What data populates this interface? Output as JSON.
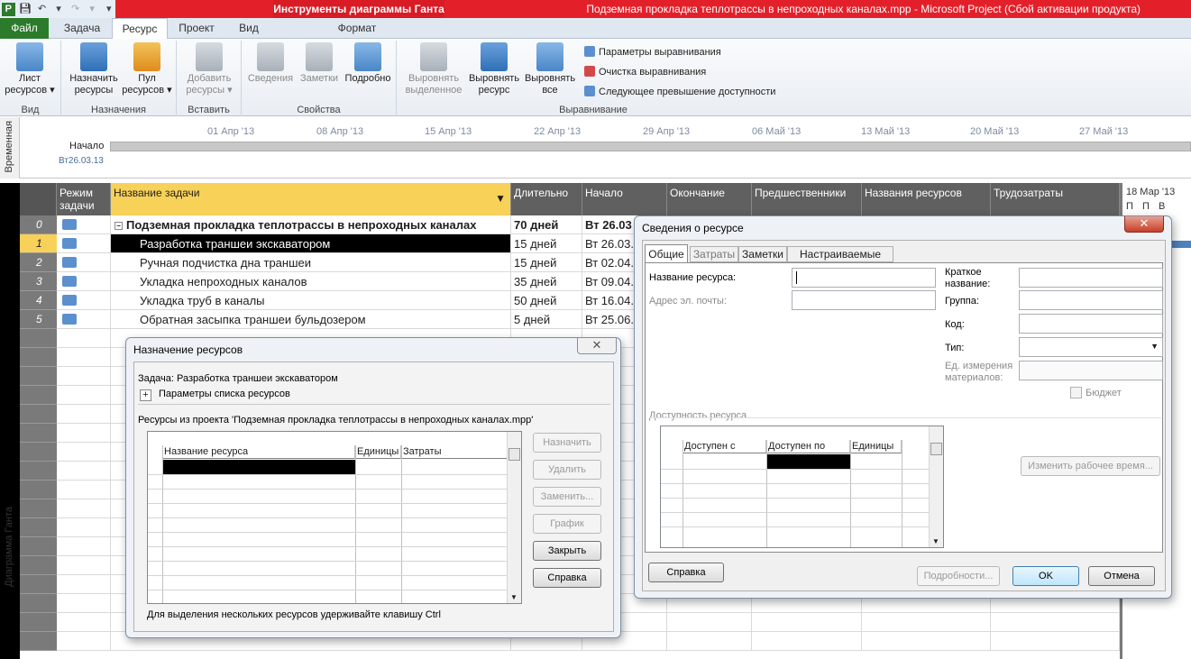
{
  "colors": {
    "titlebar": "#e3202a",
    "file_tab": "#2b7b2b",
    "selected": "#f7d158"
  },
  "titlebar": {
    "contextual_group": "Инструменты диаграммы Ганта",
    "window_title": "Подземная прокладка теплотрассы в непроходных каналах.mpp  -  Microsoft Project (Сбой активации продукта)"
  },
  "tabs": {
    "file": "Файл",
    "task": "Задача",
    "resource": "Ресурс",
    "project": "Проект",
    "view": "Вид",
    "format": "Формат"
  },
  "ribbon": {
    "view_group": "Вид",
    "resource_sheet": "Лист ресурсов",
    "assign_group": "Назначения",
    "assign_resources": "Назначить ресурсы",
    "resource_pool": "Пул ресурсов",
    "insert_group": "Вставить",
    "add_resources": "Добавить ресурсы",
    "props_group": "Свойства",
    "info": "Сведения",
    "notes": "Заметки",
    "details": "Подробно",
    "level_group": "Выравнивание",
    "level_selection": "Выровнять выделенное",
    "level_resource": "Выровнять ресурс",
    "level_all": "Выровнять все",
    "leveling_options": "Параметры выравнивания",
    "clear_leveling": "Очистка выравнивания",
    "next_overallocation": "Следующее превышение доступности"
  },
  "timeline": {
    "side_label": "Временная",
    "start_label": "Начало",
    "start_date": "Вт26.03.13",
    "dates": [
      "01 Апр '13",
      "08 Апр '13",
      "15 Апр '13",
      "22 Апр '13",
      "29 Апр '13",
      "06 Май '13",
      "13 Май '13",
      "20 Май '13",
      "27 Май '13"
    ]
  },
  "gantt": {
    "side_label": "Диаграмма Ганта",
    "headers": {
      "mode": "Режим задачи",
      "name": "Название задачи",
      "duration": "Длительно",
      "start": "Начало",
      "finish": "Окончание",
      "pred": "Предшественники",
      "resources": "Названия ресурсов",
      "work": "Трудозатраты"
    },
    "chart_header": "18 Мар '13",
    "chart_days": [
      "П",
      "П",
      "В"
    ],
    "rows": [
      {
        "id": "0",
        "name": "Подземная прокладка теплотрассы в непроходных каналах",
        "duration": "70 дней",
        "start": "Вт 26.03"
      },
      {
        "id": "1",
        "name": "Разработка траншеи экскаватором",
        "duration": "15 дней",
        "start": "Вт 26.03."
      },
      {
        "id": "2",
        "name": "Ручная подчистка дна траншеи",
        "duration": "15 дней",
        "start": "Вт 02.04."
      },
      {
        "id": "3",
        "name": "Укладка непроходных каналов",
        "duration": "35 дней",
        "start": "Вт 09.04."
      },
      {
        "id": "4",
        "name": "Укладка труб в каналы",
        "duration": "50 дней",
        "start": "Вт 16.04."
      },
      {
        "id": "5",
        "name": "Обратная засыпка траншеи бульдозером",
        "duration": "5 дней",
        "start": "Вт 25.06."
      }
    ]
  },
  "assign_dialog": {
    "title": "Назначение ресурсов",
    "task_line": "Задача: Разработка траншеи экскаватором",
    "list_options": "Параметры списка ресурсов",
    "resources_from": "Ресурсы из проекта 'Подземная прокладка теплотрассы в непроходных каналах.mpp'",
    "col_name": "Название ресурса",
    "col_units": "Единицы",
    "col_cost": "Затраты",
    "btn_assign": "Назначить",
    "btn_remove": "Удалить",
    "btn_replace": "Заменить...",
    "btn_graph": "График",
    "btn_close": "Закрыть",
    "btn_help": "Справка",
    "hint": "Для выделения нескольких ресурсов удерживайте клавишу Ctrl"
  },
  "info_dialog": {
    "title": "Сведения о ресурсе",
    "tabs": [
      "Общие",
      "Затраты",
      "Заметки",
      "Настраиваемые поля"
    ],
    "res_name": "Название ресурса:",
    "email": "Адрес эл. почты:",
    "short_name": "Краткое название:",
    "group": "Группа:",
    "code": "Код:",
    "type": "Тип:",
    "material_units": "Ед. измерения материалов:",
    "budget": "Бюджет",
    "availability": "Доступность ресурса",
    "avail_from": "Доступен с",
    "avail_to": "Доступен по",
    "avail_units": "Единицы",
    "change_work_time": "Изменить рабочее время...",
    "btn_help": "Справка",
    "btn_details": "Подробности...",
    "btn_ok": "OK",
    "btn_cancel": "Отмена"
  }
}
